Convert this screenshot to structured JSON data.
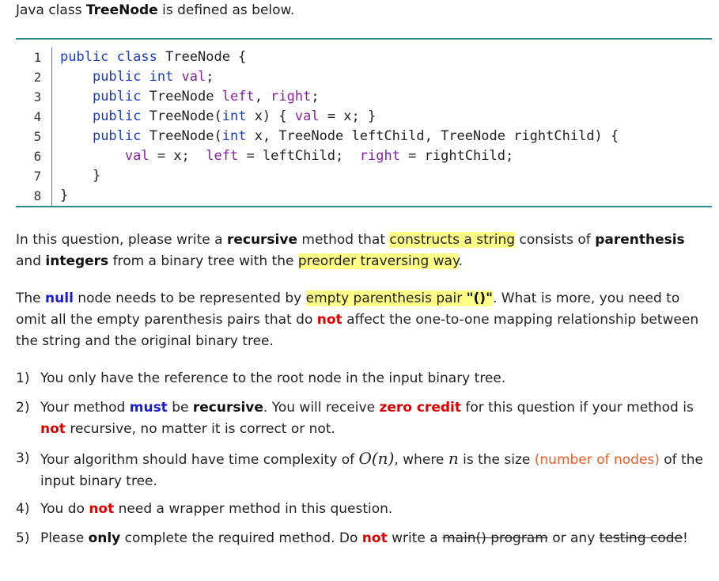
{
  "intro": {
    "pre": "Java class ",
    "cls": "TreeNode",
    "post": " is defined as below."
  },
  "code": {
    "line_numbers": [
      "1",
      "2",
      "3",
      "4",
      "5",
      "6",
      "7",
      "8"
    ],
    "lines": [
      [
        [
          "kw",
          "public class "
        ],
        [
          "t",
          "TreeNode {"
        ]
      ],
      [
        [
          "t",
          "    "
        ],
        [
          "kw",
          "public int "
        ],
        [
          "fld",
          "val"
        ],
        [
          "t",
          ";"
        ]
      ],
      [
        [
          "t",
          "    "
        ],
        [
          "kw",
          "public "
        ],
        [
          "t",
          "TreeNode "
        ],
        [
          "fld",
          "left"
        ],
        [
          "t",
          ", "
        ],
        [
          "fld",
          "right"
        ],
        [
          "t",
          ";"
        ]
      ],
      [
        [
          "t",
          "    "
        ],
        [
          "kw",
          "public "
        ],
        [
          "t",
          "TreeNode("
        ],
        [
          "kw",
          "int "
        ],
        [
          "t",
          "x) { "
        ],
        [
          "fld",
          "val"
        ],
        [
          "t",
          " = x; }"
        ]
      ],
      [
        [
          "t",
          "    "
        ],
        [
          "kw",
          "public "
        ],
        [
          "t",
          "TreeNode("
        ],
        [
          "kw",
          "int "
        ],
        [
          "t",
          "x, TreeNode leftChild, TreeNode rightChild) {"
        ]
      ],
      [
        [
          "t",
          "        "
        ],
        [
          "fld",
          "val"
        ],
        [
          "t",
          " = x;  "
        ],
        [
          "fld",
          "left"
        ],
        [
          "t",
          " = leftChild;  "
        ],
        [
          "fld",
          "right"
        ],
        [
          "t",
          " = rightChild;"
        ]
      ],
      [
        [
          "t",
          "    }"
        ]
      ],
      [
        [
          "t",
          "}"
        ]
      ]
    ]
  },
  "p1": {
    "a": "In this question, please write a ",
    "b": "recursive",
    "c": " method that ",
    "d": "constructs a string",
    "e": " consists of ",
    "f": "parenthesis",
    "g": " and ",
    "h": "integers",
    "i": " from a binary tree with the ",
    "j": "preorder traversing way",
    "k": "."
  },
  "p2": {
    "a": "The ",
    "b": "null",
    "c": " node needs to be represented by ",
    "d": "empty parenthesis pair ",
    "e": "\"()\"",
    "f": ".  What is more, you need to omit all the empty parenthesis pairs that do ",
    "g": "not",
    "h": " affect the one-to-one mapping relationship between the string and the original binary tree."
  },
  "items": {
    "i1": {
      "num": "1)",
      "text": "You only have the reference to the root node in the input binary tree."
    },
    "i2": {
      "num": "2)",
      "a": "Your method ",
      "b": "must",
      "c": " be ",
      "d": "recursive",
      "e": ".  You will receive ",
      "f": "zero credit",
      "g": " for this question if your method is ",
      "h": "not",
      "i": " recursive, no matter it is correct or not."
    },
    "i3": {
      "num": "3)",
      "a": "Your algorithm should have time complexity of ",
      "b": "O(n)",
      "c": ", where ",
      "d": "n",
      "e": " is the size ",
      "f": "(number of nodes)",
      "g": " of the input binary tree."
    },
    "i4": {
      "num": "4)",
      "a": "You do ",
      "b": "not",
      "c": " need a wrapper method in this question."
    },
    "i5": {
      "num": "5)",
      "a": "Please ",
      "b": "only",
      "c": " complete the required method.  Do ",
      "d": "not",
      "e": " write a ",
      "f": "main() program",
      "g": " or any ",
      "h": "testing code",
      "i": "!"
    }
  }
}
